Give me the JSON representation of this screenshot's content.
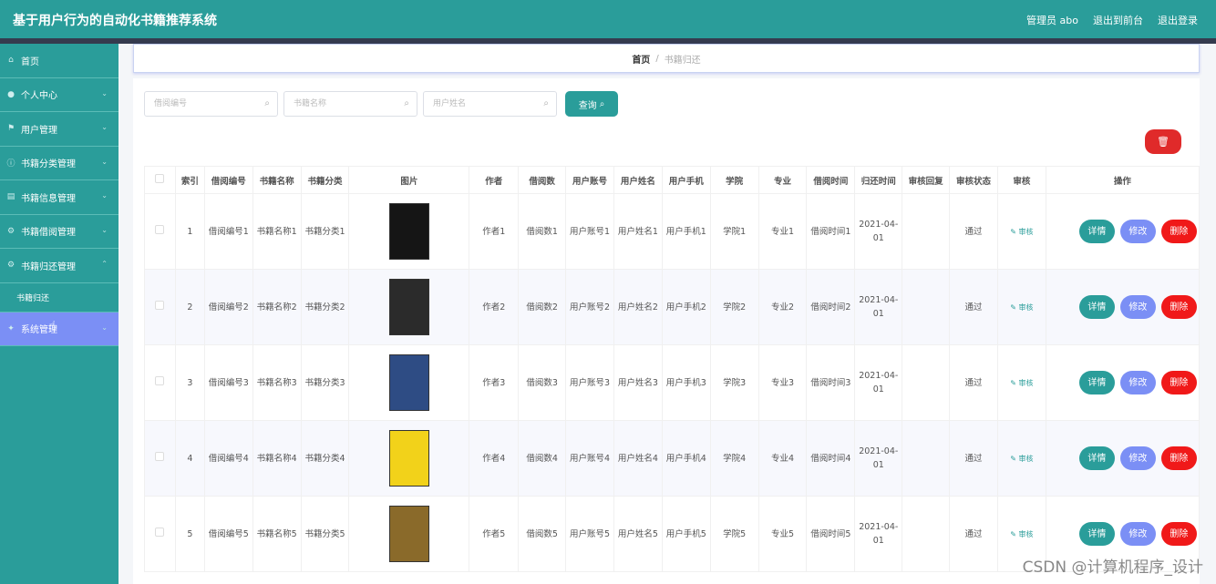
{
  "header": {
    "title": "基于用户行为的自动化书籍推荐系统",
    "admin": "管理员 abo",
    "exit_front": "退出到前台",
    "logout": "退出登录"
  },
  "sidebar": {
    "items": [
      {
        "label": "首页",
        "icon": "home-icon"
      },
      {
        "label": "个人中心",
        "icon": "user-icon"
      },
      {
        "label": "用户管理",
        "icon": "flag-icon"
      },
      {
        "label": "书籍分类管理",
        "icon": "info-icon"
      },
      {
        "label": "书籍信息管理",
        "icon": "book-icon"
      },
      {
        "label": "书籍借阅管理",
        "icon": "gear-icon"
      },
      {
        "label": "书籍归还管理",
        "icon": "gear-icon"
      },
      {
        "label": "系统管理",
        "icon": "star-icon"
      }
    ],
    "sub": "书籍归还"
  },
  "breadcrumb": {
    "home": "首页",
    "sep": "/",
    "current": "书籍归还"
  },
  "search": {
    "borrow_no": "借阅编号",
    "book_name": "书籍名称",
    "user_name": "用户姓名",
    "query_label": "查询"
  },
  "table": {
    "headers": [
      "索引",
      "借阅编号",
      "书籍名称",
      "书籍分类",
      "图片",
      "作者",
      "借阅数",
      "用户账号",
      "用户姓名",
      "用户手机",
      "学院",
      "专业",
      "借阅时间",
      "归还时间",
      "审核回复",
      "审核状态",
      "审核",
      "操作"
    ],
    "rows": [
      {
        "idx": "1",
        "no": "借阅编号1",
        "name": "书籍名称1",
        "cat": "书籍分类1",
        "author": "作者1",
        "count": "借阅数1",
        "account": "用户账号1",
        "uname": "用户姓名1",
        "phone": "用户手机1",
        "college": "学院1",
        "major": "专业1",
        "btime": "借阅时间1",
        "rtime": "2021-04-01",
        "reply": "",
        "status": "通过"
      },
      {
        "idx": "2",
        "no": "借阅编号2",
        "name": "书籍名称2",
        "cat": "书籍分类2",
        "author": "作者2",
        "count": "借阅数2",
        "account": "用户账号2",
        "uname": "用户姓名2",
        "phone": "用户手机2",
        "college": "学院2",
        "major": "专业2",
        "btime": "借阅时间2",
        "rtime": "2021-04-01",
        "reply": "",
        "status": "通过"
      },
      {
        "idx": "3",
        "no": "借阅编号3",
        "name": "书籍名称3",
        "cat": "书籍分类3",
        "author": "作者3",
        "count": "借阅数3",
        "account": "用户账号3",
        "uname": "用户姓名3",
        "phone": "用户手机3",
        "college": "学院3",
        "major": "专业3",
        "btime": "借阅时间3",
        "rtime": "2021-04-01",
        "reply": "",
        "status": "通过"
      },
      {
        "idx": "4",
        "no": "借阅编号4",
        "name": "书籍名称4",
        "cat": "书籍分类4",
        "author": "作者4",
        "count": "借阅数4",
        "account": "用户账号4",
        "uname": "用户姓名4",
        "phone": "用户手机4",
        "college": "学院4",
        "major": "专业4",
        "btime": "借阅时间4",
        "rtime": "2021-04-01",
        "reply": "",
        "status": "通过"
      },
      {
        "idx": "5",
        "no": "借阅编号5",
        "name": "书籍名称5",
        "cat": "书籍分类5",
        "author": "作者5",
        "count": "借阅数5",
        "account": "用户账号5",
        "uname": "用户姓名5",
        "phone": "用户手机5",
        "college": "学院5",
        "major": "专业5",
        "btime": "借阅时间5",
        "rtime": "2021-04-01",
        "reply": "",
        "status": "通过"
      }
    ],
    "audit_label": "审核",
    "btn_detail": "详情",
    "btn_edit": "修改",
    "btn_delete": "删除"
  },
  "covers": [
    "#151515",
    "#2b2b2b",
    "#2e4c84",
    "#f2d21a",
    "#8a6a2a"
  ],
  "watermark": "CSDN @计算机程序_设计",
  "colors": {
    "accent": "#2a9d9a",
    "active": "#7b8ff5",
    "danger": "#e02a2a"
  }
}
